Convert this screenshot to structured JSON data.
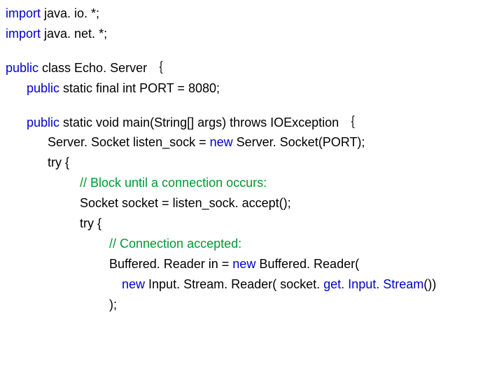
{
  "code": {
    "l1a": "import",
    "l1b": " java. io. *; ",
    "l2a": "import",
    "l2b": " java. net. *; ",
    "l3a": "public",
    "l3b": " class Echo. Server ｛",
    "l4a": "public",
    "l4b": " static final int PORT = 8080; ",
    "l5a": "public",
    "l5b": " static void main(String[] args) throws IOException ｛",
    "l6a": "Server. Socket listen_sock = ",
    "l6b": "new",
    "l6c": " Server. Socket(PORT); ",
    "l7": "try {",
    "l8": "// Block until a connection occurs: ",
    "l9a": "Socket socket = listen_sock. accept(); ",
    "l10": "try {",
    "l11": "// Connection accepted: ",
    "l12a": "Buffered. Reader in = ",
    "l12b": "new",
    "l12c": " Buffered. Reader(",
    "l13a": "new",
    "l13b": " Input. Stream. Reader( socket. ",
    "l13c": "get. Input. Stream",
    "l13d": "())",
    "l14": "); "
  }
}
